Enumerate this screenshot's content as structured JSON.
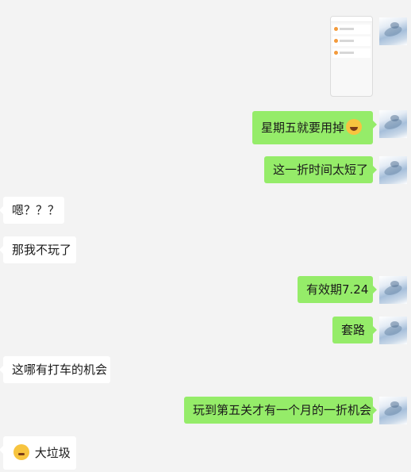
{
  "messages": [
    {
      "sender": "me",
      "type": "image"
    },
    {
      "sender": "me",
      "text": "星期五就要用掉",
      "emoji": "laughing-tears"
    },
    {
      "sender": "me",
      "text": "这一折时间太短了"
    },
    {
      "sender": "other",
      "text": "嗯？？？"
    },
    {
      "sender": "other",
      "text": "那我不玩了"
    },
    {
      "sender": "me",
      "text": "有效期7.24"
    },
    {
      "sender": "me",
      "text": "套路"
    },
    {
      "sender": "other",
      "text": "这哪有打车的机会"
    },
    {
      "sender": "me",
      "text": "玩到第五关才有一个月的一折机会"
    },
    {
      "sender": "other",
      "text": "大垃圾",
      "emoji": "disgusted-face"
    }
  ],
  "colors": {
    "background": "#f3f3f3",
    "my_bubble": "#95ec69",
    "other_bubble": "#ffffff"
  }
}
